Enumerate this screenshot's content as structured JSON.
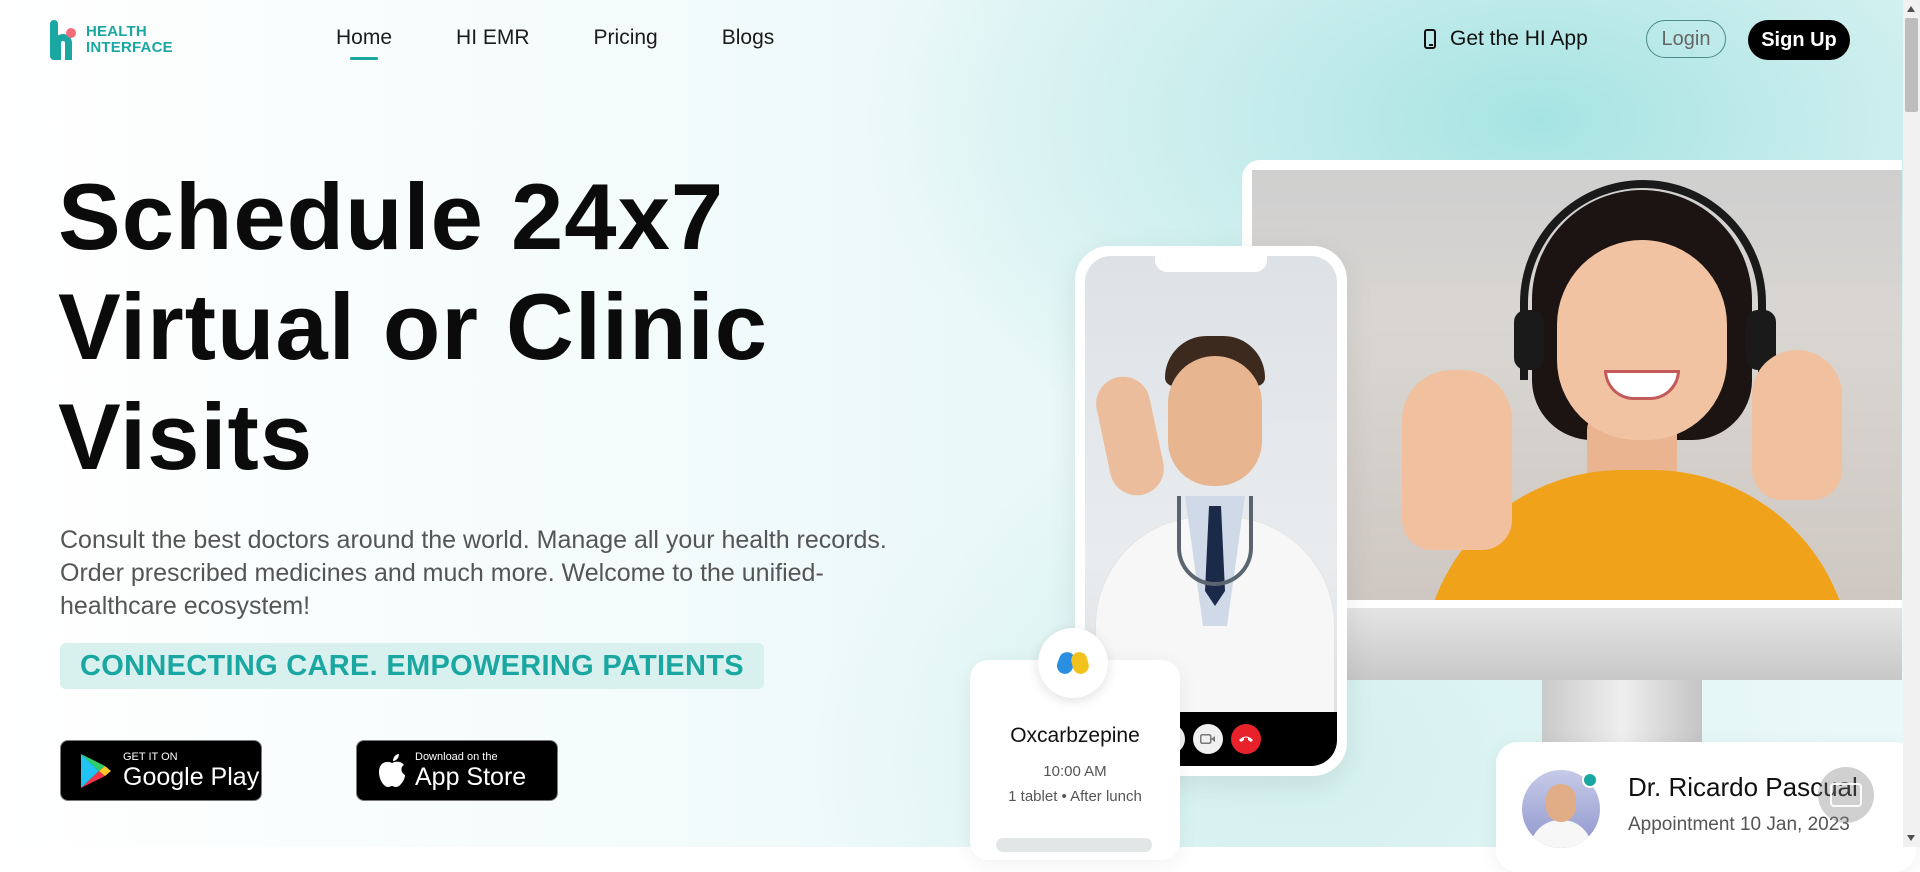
{
  "brand": {
    "line1": "HEALTH",
    "line2": "INTERFACE"
  },
  "nav": {
    "items": [
      {
        "label": "Home",
        "active": true
      },
      {
        "label": "HI EMR"
      },
      {
        "label": "Pricing"
      },
      {
        "label": "Blogs"
      }
    ]
  },
  "header": {
    "get_app_label": "Get the HI App",
    "login_label": "Login",
    "signup_label": "Sign Up"
  },
  "hero": {
    "title_lines": [
      "Schedule 24x7",
      "Virtual or Clinic",
      "Visits"
    ],
    "subtitle_lines": [
      "Consult the best doctors around the world. Manage all your health records.",
      "Order prescribed medicines and much more. Welcome to the unified-",
      "healthcare ecosystem!"
    ],
    "tagline": "CONNECTING CARE. EMPOWERING PATIENTS",
    "google_play": {
      "small": "GET IT ON",
      "big": "Google Play"
    },
    "app_store": {
      "small": "Download on the",
      "big": "App Store"
    }
  },
  "medicine_card": {
    "name": "Oxcarbzepine",
    "time": "10:00 AM",
    "dose": "1 tablet • After lunch"
  },
  "doctor_card": {
    "name": "Dr. Ricardo Pascual",
    "appointment": "Appointment 10 Jan, 2023"
  },
  "colors": {
    "accent": "#1aa7a1",
    "tag_bg": "#d8f1ef",
    "end_call": "#e8222b"
  },
  "icons": [
    "phone-icon",
    "google-play-icon",
    "apple-icon",
    "mic-icon",
    "video-icon",
    "end-call-icon",
    "pill-icon",
    "chat-icon"
  ]
}
